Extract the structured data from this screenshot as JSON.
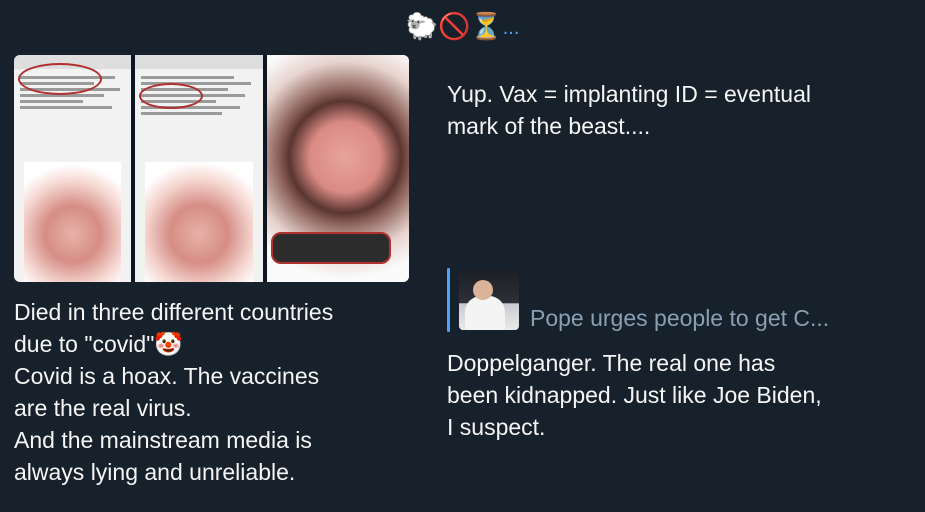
{
  "header": {
    "emoji": "🐑🚫⏳",
    "dots": "..."
  },
  "left_message": {
    "line1": "Died in three different countries",
    "line2": "due to \"covid\"🤡",
    "line3": "Covid is a hoax. The vaccines",
    "line4": "are the real virus.",
    "line5": "And the mainstream media is",
    "line6": "always lying and unreliable."
  },
  "right_message": {
    "line1": "Yup. Vax = implanting ID = eventual",
    "line2": "mark of the beast...."
  },
  "quoted_link": {
    "title": "Pope urges people to get C..."
  },
  "reply": {
    "line1": "Doppelganger. The real one has",
    "line2": "been kidnapped. Just like Joe Biden,",
    "line3": "I suspect."
  },
  "colors": {
    "background": "#17212b",
    "accent": "#4ea4f6",
    "muted": "#8a9fb3"
  }
}
